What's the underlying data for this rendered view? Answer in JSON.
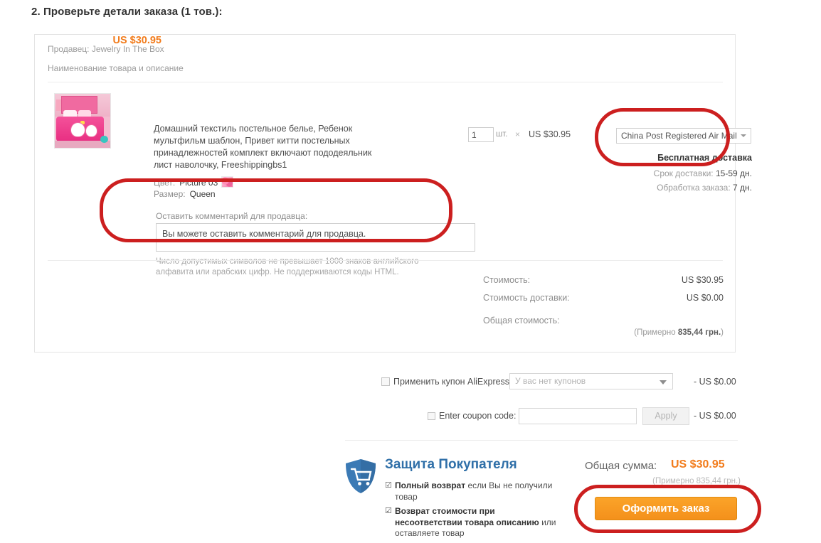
{
  "step": {
    "title": "2. Проверьте детали заказа (1 тов.):"
  },
  "order_card": {
    "seller_line": "Продавец: Jewelry In The Box",
    "item_header": "Наименование товара и описание",
    "product": {
      "title": "Домашний текстиль постельное белье, Ребенок мультфильм шаблон, Привет китти постельных принадлежностей комплект включают пододеяльник лист наволочку, Freeshippingbs1",
      "thumbnail_name": "hello-kitty-bedding-set-photo",
      "color_label": "Цвет:",
      "color_value": "Picture 03",
      "size_label": "Размер:",
      "size_value": "Queen"
    },
    "quantity": {
      "value": "1",
      "unit": "шт.",
      "multiply_sign": "×",
      "unit_price": "US $30.95"
    },
    "shipping": {
      "method_selected": "China Post Registered Air Mail",
      "free_label": "Бесплатная доставка",
      "delivery_time_label": "Срок доставки:",
      "delivery_time_value": "15-59 дн.",
      "processing_label": "Обработка заказа:",
      "processing_value": "7 дн."
    },
    "comment": {
      "label": "Оставить комментарий для продавца:",
      "value": "Вы можете оставить комментарий для продавца.",
      "placeholder": "Вы можете оставить комментарий для продавца.",
      "hint": "Число допустимых символов не превышает 1000 знаков английского алфавита или арабских цифр. Не поддерживаются коды HTML."
    },
    "totals": {
      "subtotal_label": "Стоимость:",
      "subtotal_value": "US $30.95",
      "shipping_label": "Стоимость доставки:",
      "shipping_value": "US $0.00",
      "total_label": "Общая стоимость:",
      "total_value": "US $30.95",
      "total_approx_prefix": "(Примерно",
      "total_approx_amount": "835,44 грн.",
      "total_approx_suffix": ")"
    }
  },
  "coupons": {
    "aliexpress": {
      "checkbox_name": "apply-aliexpress-coupon-checkbox",
      "label": "Применить купон AliExpress:",
      "select_value": "У вас нет купонов",
      "discount": "- US $0.00"
    },
    "code": {
      "checkbox_name": "enter-coupon-code-checkbox",
      "label": "Enter coupon code:",
      "input_value": "",
      "input_placeholder": "",
      "apply_label": "Apply",
      "discount": "- US $0.00"
    }
  },
  "buyer_protection": {
    "icon": "shield-cart-icon",
    "title": "Защита Покупателя",
    "items": [
      {
        "tick": "☑",
        "strong": "Полный возврат",
        "rest": " если Вы не получили товар"
      },
      {
        "tick": "☑",
        "strong": "Возврат стоимости при несоответствии товара описанию",
        "rest": " или оставляете товар"
      }
    ]
  },
  "checkout": {
    "grand_total_label": "Общая сумма:",
    "grand_total_value": "US $30.95",
    "grand_total_approx": "(Примерно 835,44 грн.)",
    "cta_label": "Оформить заказ"
  },
  "annotations": {
    "color": "#cc1f1f",
    "regions": [
      "shipping-info-highlight",
      "seller-comment-highlight",
      "place-order-button-highlight"
    ]
  },
  "colors": {
    "accent_orange": "#f27c1c",
    "protection_blue": "#2f6fa8",
    "annotation_red": "#cc1f1f"
  }
}
